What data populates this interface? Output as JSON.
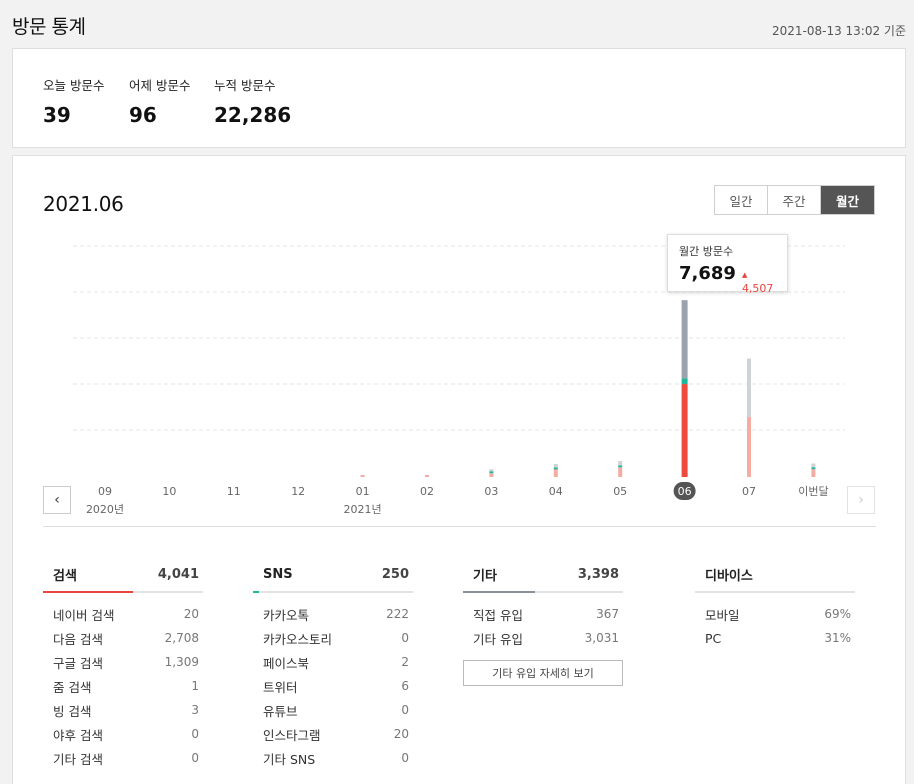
{
  "header": {
    "title": "방문 통계",
    "timestamp": "2021-08-13 13:02 기준"
  },
  "summary": [
    {
      "label": "오늘 방문수",
      "value": "39"
    },
    {
      "label": "어제 방문수",
      "value": "96"
    },
    {
      "label": "누적 방문수",
      "value": "22,286"
    }
  ],
  "chart_section": {
    "period": "2021.06",
    "tabs": [
      {
        "label": "일간"
      },
      {
        "label": "주간"
      },
      {
        "label": "월간",
        "active": true
      }
    ],
    "tooltip": {
      "label": "월간 방문수",
      "value": "7,689",
      "diff_arrow": "▲",
      "diff": "4,507"
    },
    "prev_icon": "‹",
    "next_icon": "›"
  },
  "colors": {
    "current": "#ee4b3e",
    "past": "#f4aca3",
    "gray_current": "#9aa3ae",
    "gray_past": "#cfd3d5",
    "teal": "#1fb79a",
    "accent_search": "#e8453c",
    "accent_sns": "#1fb79a",
    "accent_etc": "#8a9299"
  },
  "chart_data": {
    "type": "bar",
    "categories": [
      "09",
      "10",
      "11",
      "12",
      "01",
      "02",
      "03",
      "04",
      "05",
      "06",
      "07",
      "이번달"
    ],
    "year_labels": [
      "2020년",
      "",
      "",
      "",
      "2021년",
      "",
      "",
      "",
      "",
      "",
      "",
      ""
    ],
    "selected_index": 9,
    "stack_order_bottom_to_top": [
      "검색",
      "SNS",
      "기타"
    ],
    "series": [
      {
        "name": "검색",
        "values": [
          0,
          0,
          0,
          0,
          15,
          35,
          165,
          330,
          420,
          4041,
          2610,
          340
        ]
      },
      {
        "name": "SNS",
        "values": [
          0,
          0,
          0,
          0,
          0,
          0,
          8,
          15,
          30,
          250,
          0,
          20
        ]
      },
      {
        "name": "기타",
        "values": [
          0,
          0,
          0,
          0,
          0,
          0,
          60,
          150,
          190,
          3398,
          2540,
          160
        ]
      }
    ],
    "ylim": [
      0,
      10000
    ],
    "grid": true
  },
  "columns": [
    {
      "title": "검색",
      "total": "4,041",
      "accent": "#e8453c",
      "fill_percent": 56,
      "rows": [
        {
          "label": "네이버 검색",
          "value": "20"
        },
        {
          "label": "다음 검색",
          "value": "2,708"
        },
        {
          "label": "구글 검색",
          "value": "1,309"
        },
        {
          "label": "줌 검색",
          "value": "1"
        },
        {
          "label": "빙 검색",
          "value": "3"
        },
        {
          "label": "야후 검색",
          "value": "0"
        },
        {
          "label": "기타 검색",
          "value": "0"
        }
      ]
    },
    {
      "title": "SNS",
      "total": "250",
      "accent": "#1fb79a",
      "fill_percent": 4,
      "rows": [
        {
          "label": "카카오톡",
          "value": "222"
        },
        {
          "label": "카카오스토리",
          "value": "0"
        },
        {
          "label": "페이스북",
          "value": "2"
        },
        {
          "label": "트위터",
          "value": "6"
        },
        {
          "label": "유튜브",
          "value": "0"
        },
        {
          "label": "인스타그램",
          "value": "20"
        },
        {
          "label": "기타 SNS",
          "value": "0"
        }
      ]
    },
    {
      "title": "기타",
      "total": "3,398",
      "accent": "#8a9299",
      "fill_percent": 45,
      "rows": [
        {
          "label": "직접 유입",
          "value": "367"
        },
        {
          "label": "기타 유입",
          "value": "3,031"
        }
      ],
      "button": "기타 유입 자세히 보기"
    },
    {
      "title": "디바이스",
      "total": "",
      "accent": "#e3e3e3",
      "fill_percent": 0,
      "rows": [
        {
          "label": "모바일",
          "value": "69%"
        },
        {
          "label": "PC",
          "value": "31%"
        }
      ]
    }
  ]
}
